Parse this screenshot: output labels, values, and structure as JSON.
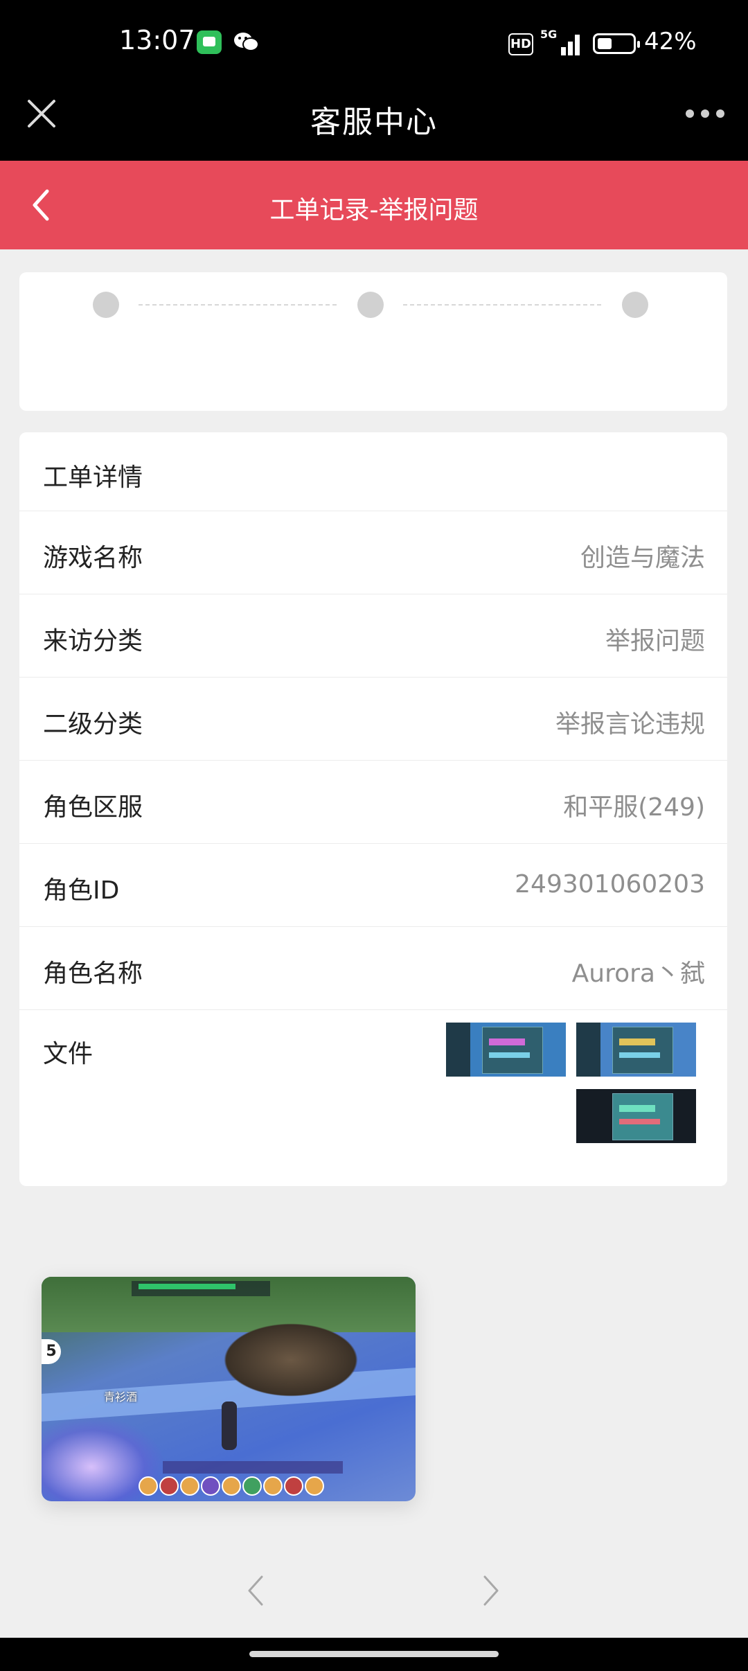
{
  "status_bar": {
    "time": "13:07",
    "hd": "HD",
    "network": "5G",
    "battery_level": 0.42,
    "battery_text": "42%"
  },
  "webview": {
    "title": "客服中心",
    "close_icon": "close-icon",
    "more_icon": "more-icon"
  },
  "header": {
    "title": "工单记录-举报问题",
    "back_icon": "back-arrow-icon",
    "color": "#e74a5a"
  },
  "progress": {
    "step_count": 3
  },
  "detail": {
    "heading": "工单详情",
    "rows": [
      {
        "label": "游戏名称",
        "value": "创造与魔法"
      },
      {
        "label": "来访分类",
        "value": "举报问题"
      },
      {
        "label": "二级分类",
        "value": "举报言论违规"
      },
      {
        "label": "角色区服",
        "value": "和平服(249)"
      },
      {
        "label": "角色ID",
        "value": "249301060203"
      },
      {
        "label": "角色名称",
        "value": "Aurora丶弑"
      }
    ],
    "file_label": "文件",
    "file_count": 3
  },
  "preview": {
    "character_name": "青衫酒",
    "badge": "5"
  },
  "pager": {
    "prev_icon": "chevron-left-icon",
    "next_icon": "chevron-right-icon"
  }
}
